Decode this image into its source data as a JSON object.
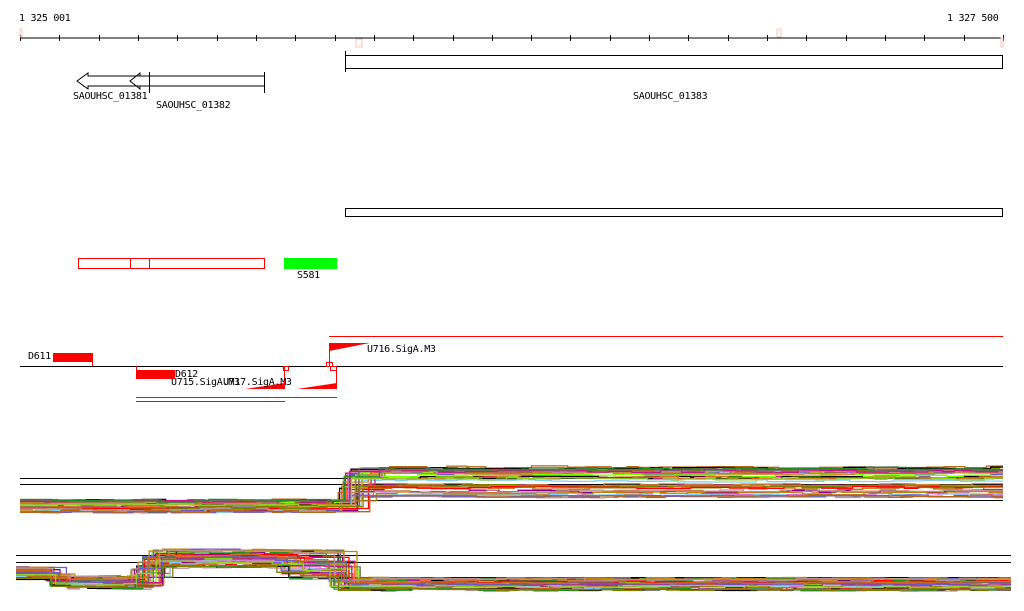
{
  "ruler": {
    "start_label": "1 325 001",
    "end_label": "1 327 500"
  },
  "genes": [
    {
      "name": "SAOUHSC_01381",
      "strand": "-"
    },
    {
      "name": "SAOUHSC_01382",
      "strand": "-"
    },
    {
      "name": "SAOUHSC_01383",
      "strand": "+"
    }
  ],
  "segments": [
    {
      "name": "S581",
      "color": "#00ff00"
    }
  ],
  "features": {
    "d611": "D611",
    "d612": "D612",
    "u715": "U715.SigA.M3",
    "u716": "U716.SigA.M3",
    "u717": "U717.SigA.M3"
  },
  "colors": {
    "feature_red": "#ff0000",
    "segment_green": "#00ff00",
    "marker": "#f5c6b8",
    "profile_palette": [
      "#b5651d",
      "#d2691e",
      "#9acd32",
      "#808000",
      "#ff6347",
      "#8b008b",
      "#87cefa",
      "#000000",
      "#ff0000",
      "#da70d6",
      "#7cfc00",
      "#cd853f",
      "#b8860b",
      "#c71585",
      "#696969",
      "#bc8f8f",
      "#6a5acd",
      "#228b22"
    ]
  }
}
